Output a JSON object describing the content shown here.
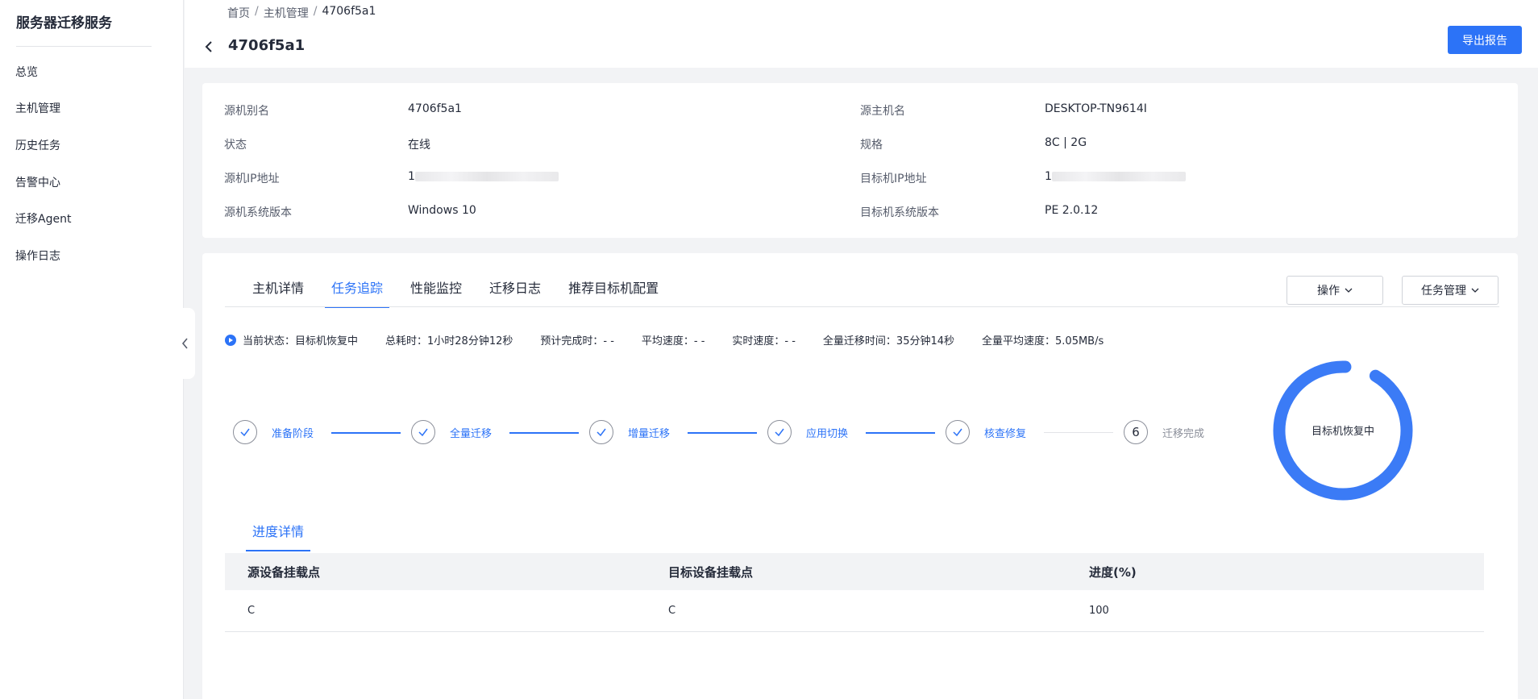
{
  "sidebar": {
    "title": "服务器迁移服务",
    "items": [
      {
        "label": "总览"
      },
      {
        "label": "主机管理"
      },
      {
        "label": "历史任务"
      },
      {
        "label": "告警中心"
      },
      {
        "label": "迁移Agent"
      },
      {
        "label": "操作日志"
      }
    ]
  },
  "header": {
    "breadcrumb": [
      "首页",
      "主机管理",
      "4706f5a1"
    ],
    "breadcrumb_sep": "/",
    "title": "4706f5a1",
    "export_label": "导出报告"
  },
  "info": {
    "source_alias_label": "源机别名",
    "source_alias_value": "4706f5a1",
    "source_hostname_label": "源主机名",
    "source_hostname_value": "DESKTOP-TN9614I",
    "status_label": "状态",
    "status_value": "在线",
    "spec_label": "规格",
    "spec_value": "8C | 2G",
    "source_ip_label": "源机IP地址",
    "source_ip_value": "1",
    "target_ip_label": "目标机IP地址",
    "target_ip_value": "1",
    "source_os_label": "源机系统版本",
    "source_os_value": "Windows 10",
    "target_os_label": "目标机系统版本",
    "target_os_value": "PE 2.0.12"
  },
  "tabs": [
    {
      "label": "主机详情",
      "active": false
    },
    {
      "label": "任务追踪",
      "active": true
    },
    {
      "label": "性能监控",
      "active": false
    },
    {
      "label": "迁移日志",
      "active": false
    },
    {
      "label": "推荐目标机配置",
      "active": false
    }
  ],
  "actions": {
    "operate_label": "操作",
    "task_manage_label": "任务管理"
  },
  "status": {
    "current": "当前状态：目标机恢复中",
    "total_time": "总耗时：1小时28分钟12秒",
    "eta": "预计完成时：- -",
    "avg_speed": "平均速度：- -",
    "realtime_speed": "实时速度：- -",
    "full_time": "全量迁移时间：35分钟14秒",
    "full_avg_speed": "全量平均速度：5.05MB/s"
  },
  "steps": [
    {
      "label": "准备阶段",
      "done": true
    },
    {
      "label": "全量迁移",
      "done": true
    },
    {
      "label": "增量迁移",
      "done": true
    },
    {
      "label": "应用切换",
      "done": true
    },
    {
      "label": "核查修复",
      "done": true
    },
    {
      "label": "迁移完成",
      "done": false,
      "number": "6"
    }
  ],
  "donut": {
    "label": "目标机恢复中",
    "progress": 0.92,
    "color": "#3b7bf6"
  },
  "progress_tab": "进度详情",
  "table": {
    "headers": [
      "源设备挂载点",
      "目标设备挂载点",
      "进度(%)"
    ],
    "rows": [
      [
        "C",
        "C",
        "100"
      ]
    ]
  },
  "colors": {
    "accent": "#2c73f7"
  }
}
